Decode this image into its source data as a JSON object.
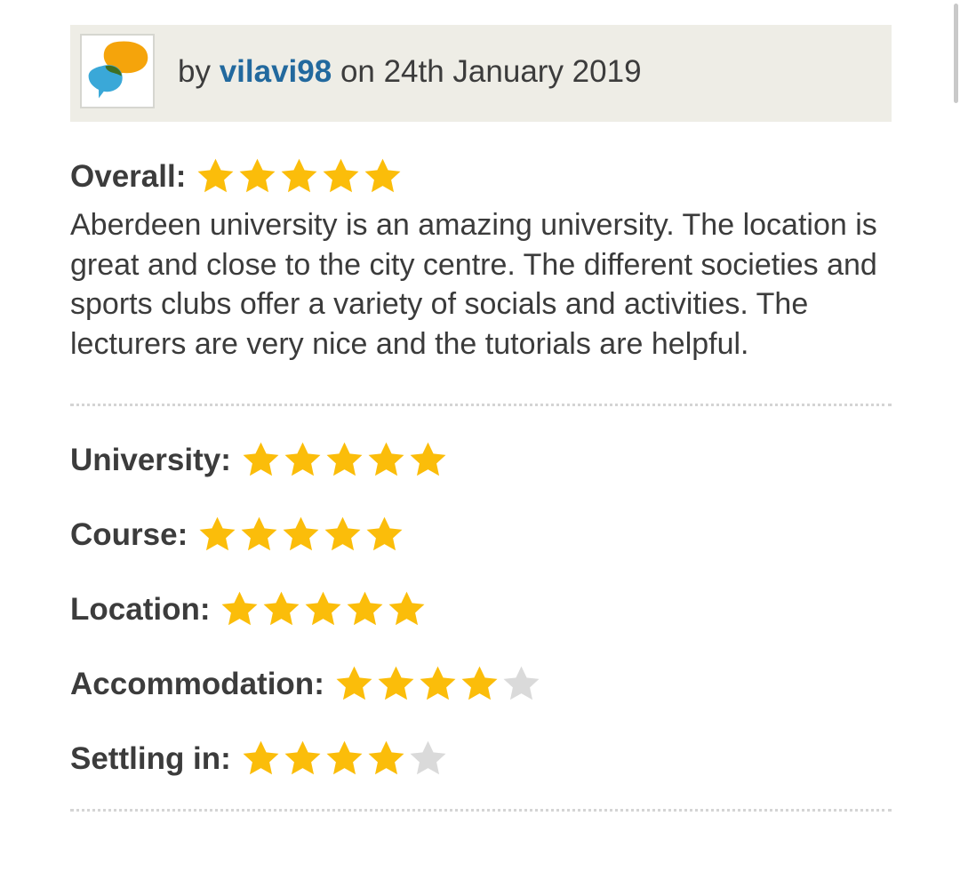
{
  "review": {
    "byline_prefix": "by",
    "author": "vilavi98",
    "date_text": "on 24th January 2019",
    "avatar_icon": "speech-bubbles-icon",
    "overall": {
      "label": "Overall:",
      "stars": 5,
      "max": 5
    },
    "text": "Aberdeen university is an amazing university. The location is great and close to the city centre. The different societies and sports clubs offer a variety of socials and activities. The lecturers are very nice and the tutorials are helpful.",
    "sub_ratings": [
      {
        "label": "University:",
        "stars": 5,
        "max": 5
      },
      {
        "label": "Course:",
        "stars": 5,
        "max": 5
      },
      {
        "label": "Location:",
        "stars": 5,
        "max": 5
      },
      {
        "label": "Accommodation:",
        "stars": 4,
        "max": 5
      },
      {
        "label": "Settling in:",
        "stars": 4,
        "max": 5
      }
    ]
  },
  "colors": {
    "star_filled": "#fbbd0a",
    "star_empty": "#dadada",
    "author_link": "#22699e",
    "header_bg": "#eeede6"
  }
}
